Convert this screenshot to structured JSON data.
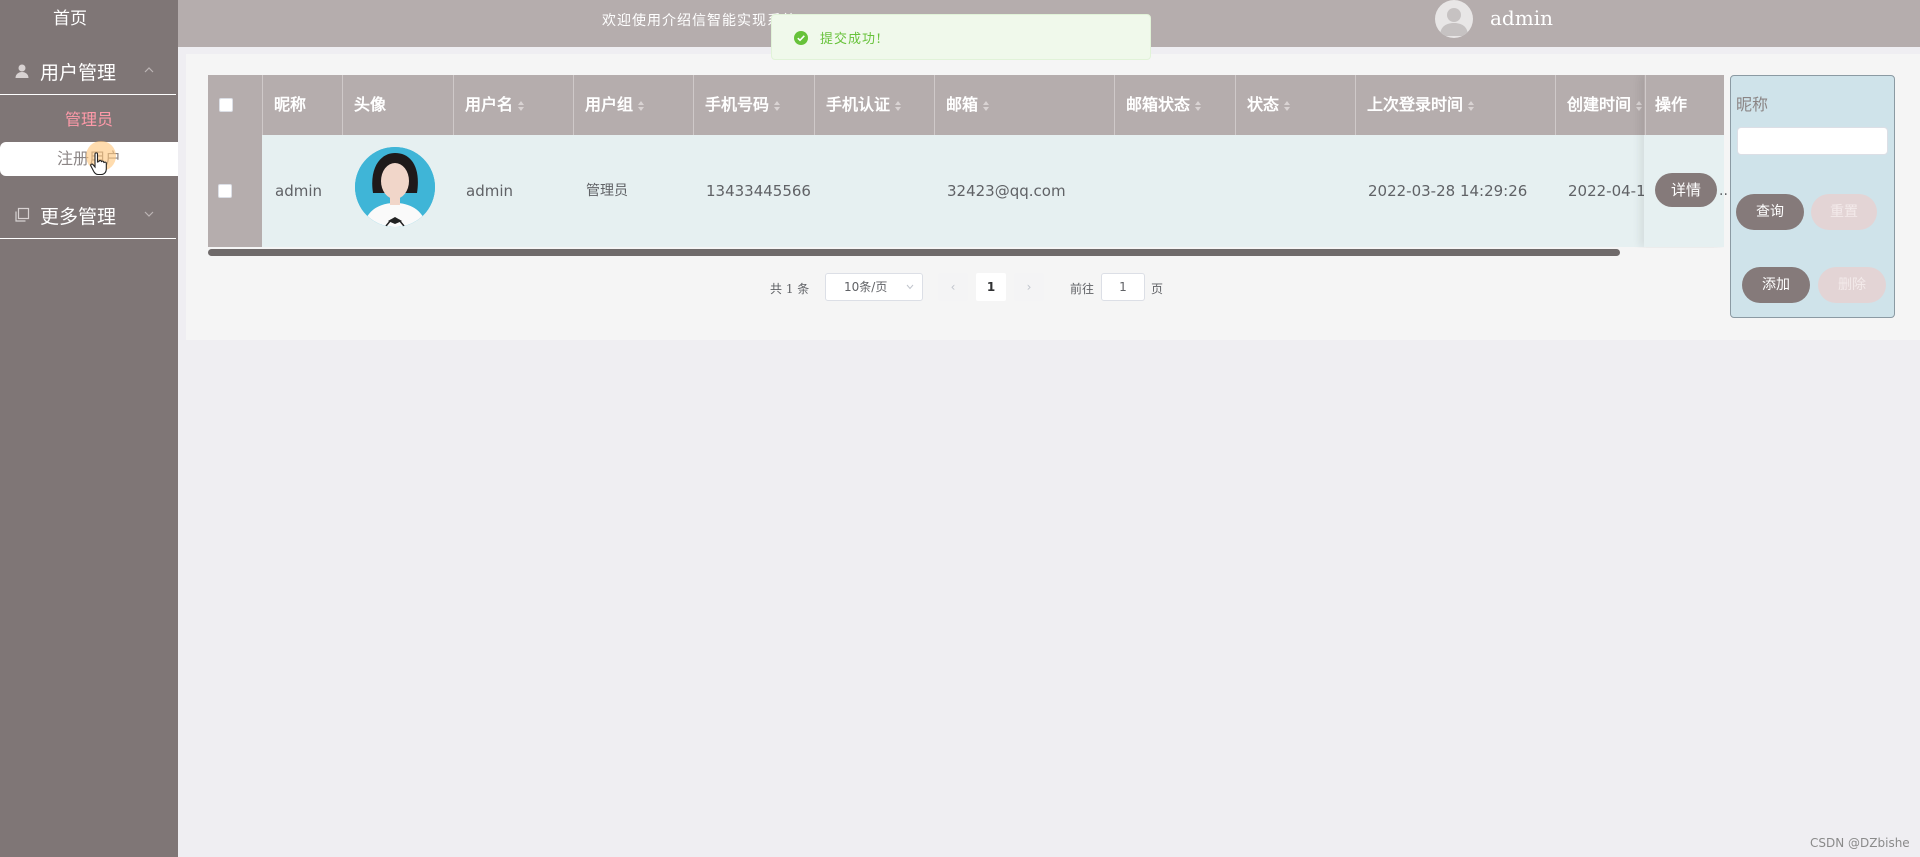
{
  "sidebar": {
    "home": "首页",
    "groups": [
      {
        "label": "用户管理",
        "icon": "user-icon",
        "expanded": true,
        "items": [
          "管理员",
          "注册用户"
        ],
        "active_item": "注册用户"
      },
      {
        "label": "更多管理",
        "icon": "copy-icon",
        "expanded": false
      }
    ]
  },
  "header": {
    "welcome": "欢迎使用介绍信智能实现系统",
    "username": "admin"
  },
  "toast": {
    "message": "提交成功!",
    "type": "success"
  },
  "table": {
    "columns": [
      "昵称",
      "头像",
      "用户名",
      "用户组",
      "手机号码",
      "手机认证",
      "邮箱",
      "邮箱状态",
      "状态",
      "上次登录时间",
      "创建时间",
      "操作"
    ],
    "rows": [
      {
        "nickname": "admin",
        "username": "admin",
        "group": "管理员",
        "phone": "13433445566",
        "phone_verified": "",
        "email": "32423@qq.com",
        "email_status": "",
        "status": "",
        "last_login": "2022-03-28 14:29:26",
        "created": "2022-04-1",
        "action": "详情"
      }
    ],
    "ellipsis": ".."
  },
  "pagination": {
    "total": "共 1 条",
    "page_size": "10条/页",
    "current_page": "1",
    "goto_label": "前往",
    "goto_value": "1",
    "page_suffix": "页",
    "prev": "‹",
    "next": "›"
  },
  "search_panel": {
    "label": "昵称",
    "input_value": "",
    "query": "查询",
    "reset": "重置",
    "add": "添加",
    "delete": "删除"
  },
  "watermark": "CSDN @DZbishe",
  "colors": {
    "sidebar_bg": "#7f7676",
    "header_bg": "#b5adad",
    "accent_pink": "#ff9aa9",
    "button_dark": "#857a7a",
    "button_light": "#e3d4d5",
    "success_green": "#67c23a",
    "panel_blue": "#cfe3ea"
  }
}
